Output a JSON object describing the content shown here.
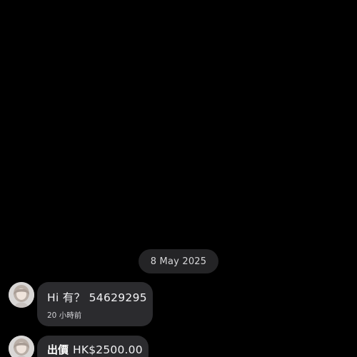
{
  "chat": {
    "date_separator": "8 May 2025",
    "messages": [
      {
        "text": "Hi 有？  54629295",
        "time": "20 小時前",
        "avatar_icon": "user-avatar-icon"
      },
      {
        "offer_label": "出價",
        "offer_price": "HK$2500.00",
        "avatar_icon": "user-avatar-icon"
      }
    ]
  },
  "colors": {
    "background": "#000000",
    "bubble": "#2b2b2e",
    "date_pill": "#242426"
  }
}
